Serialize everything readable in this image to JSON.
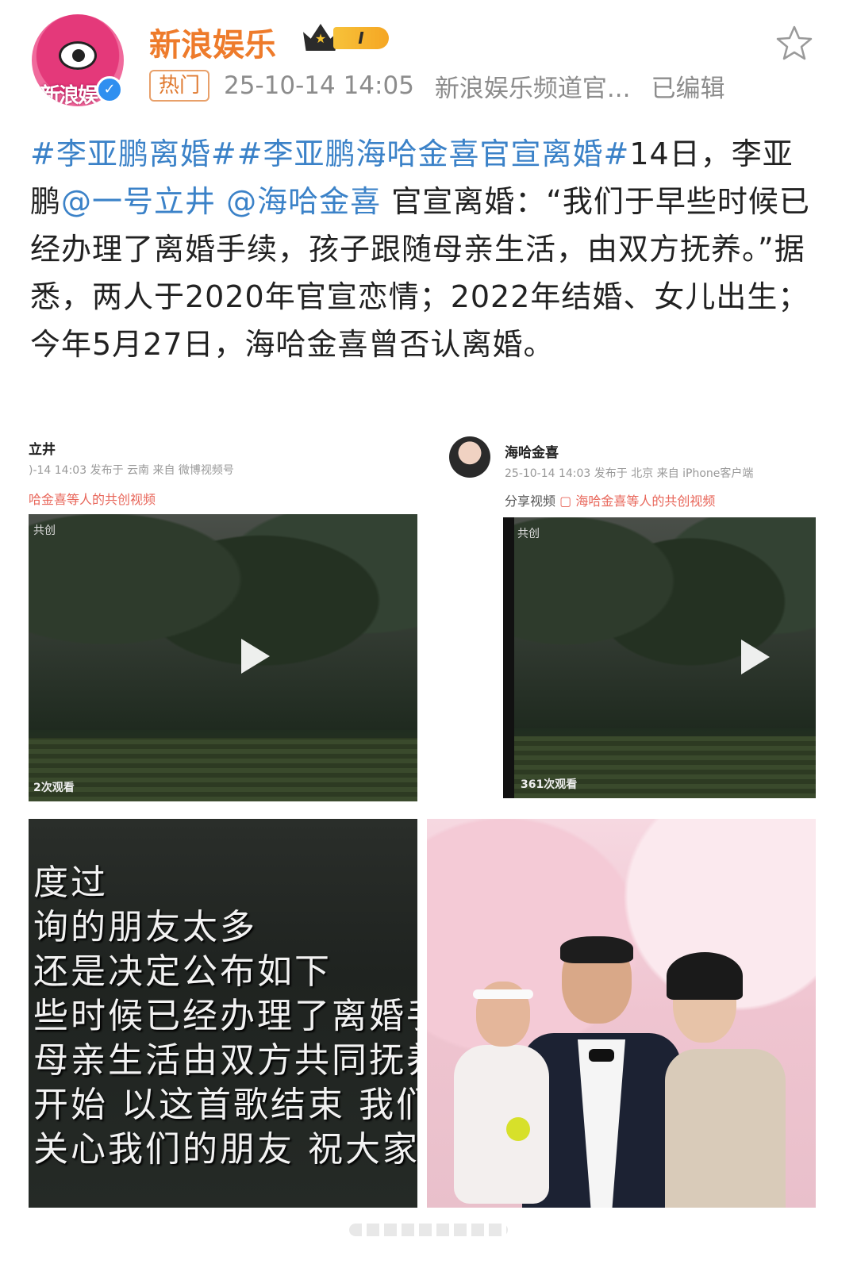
{
  "header": {
    "username": "新浪娱乐",
    "vip_level": "I",
    "verified_icon": "v-check-icon",
    "hot_badge": "热门",
    "timestamp": "25-10-14 14:05",
    "source": "新浪娱乐频道官...",
    "edited": "已编辑",
    "avatar_text": "新浪娱"
  },
  "post": {
    "hashtag1": "#李亚鹏离婚#",
    "hashtag2": "#李亚鹏海哈金喜官宣离婚#",
    "text1": "14日，李亚鹏",
    "mention1": "@一号立井",
    "mention2": "@海哈金喜",
    "text2": "官宣离婚：“我们于早些时候已经办理了离婚手续，孩子跟随母亲生活，由双方抚养。”据悉，两人于2020年官宣恋情；2022年结婚、女儿出生；今年5月27日，海哈金喜曾否认离婚。"
  },
  "images": {
    "shot1": {
      "name": "立井",
      "sub": ")-14 14:03 发布于 云南 来自 微博视频号",
      "share": "哈金喜等人的共创视频",
      "tag": "共创",
      "views": "2次观看"
    },
    "shot2": {
      "name": "海哈金喜",
      "sub": "25-10-14 14:03 发布于 北京 来自 iPhone客户端",
      "share_plain": "分享视频",
      "share": "海哈金喜等人的共创视频",
      "tag": "共创",
      "views": "361次观看"
    },
    "lyrics": [
      "度过",
      "询的朋友太多",
      " 还是决定公布如下",
      "些时候已经办理了离婚手",
      "母亲生活由双方共同抚养",
      "开始 以这首歌结束 我们",
      "关心我们的朋友 祝大家一"
    ]
  },
  "colors": {
    "username": "#ee7b2b",
    "link": "#3b82c8",
    "meta": "#8c8c8c"
  }
}
